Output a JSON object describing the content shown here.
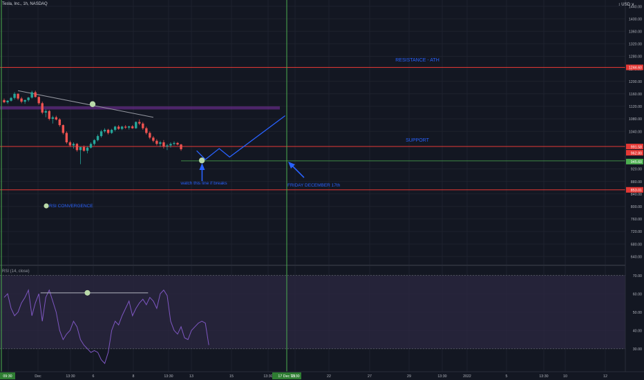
{
  "header": {
    "symbol": "Tesla, Inc., 1h, NASDAQ",
    "currency": "↕ USD ∨"
  },
  "rsi": {
    "title": "RSI (14, close)"
  },
  "annotations": {
    "resistance": "RESISTANCE - ATH",
    "support": "SUPPORT",
    "watch": "watch this line if breaks",
    "friday": "FRIDAY DECEMBER 17th",
    "rsi_conv": "RSI CONVERGENCE"
  },
  "colors": {
    "background": "#131722",
    "grid": "#1e222d",
    "up": "#26a69a",
    "down": "#ef5350",
    "level": "#e53935",
    "vline": "#4caf50",
    "projection": "#2962ff",
    "zone": "#7b2fa3",
    "marker": "#b9d9a8",
    "rsi_line": "#7e57c2",
    "rsi_band": "#2a2740",
    "axis_text": "#b2b5be"
  },
  "chart_data": [
    {
      "type": "candlestick",
      "title": "Tesla, Inc., 1h, NASDAQ",
      "y_axis_ticks": [
        640,
        680,
        720,
        760,
        800,
        840,
        880,
        920,
        1040,
        1080,
        1120,
        1160,
        1200,
        1240,
        1280,
        1320,
        1360,
        1400,
        1440
      ],
      "ylim": [
        625,
        1460
      ],
      "x_axis_labels": [
        "09:30",
        "Dec",
        "13:30",
        "6",
        "8",
        "13:30",
        "13",
        "15",
        "13:30",
        "17 Dec '21",
        "13:30",
        "22",
        "27",
        "29",
        "13:30",
        "2022",
        "5",
        "13:30",
        "10",
        "12"
      ],
      "price_labels": [
        {
          "text": "1244.60",
          "value": 1244.6,
          "color": "#e53935"
        },
        {
          "text": "991.58",
          "value": 991.58,
          "color": "#e53935"
        },
        {
          "text": "962.80",
          "value": 962.8,
          "color": "#e53935"
        },
        {
          "text": "945.60",
          "value": 945.6,
          "color": "#4caf50"
        },
        {
          "text": "853.01",
          "value": 853.01,
          "color": "#e53935"
        }
      ],
      "levels": [
        {
          "value": 1244.6,
          "label": "RESISTANCE - ATH"
        },
        {
          "value": 991.58,
          "label": "SUPPORT"
        },
        {
          "value": 853.01,
          "label": ""
        }
      ],
      "watch_level": 945.6,
      "zone": [
        1110,
        1120
      ],
      "candles": [
        [
          1140,
          1145,
          1130,
          1133
        ],
        [
          1133,
          1140,
          1128,
          1138
        ],
        [
          1138,
          1150,
          1135,
          1147
        ],
        [
          1147,
          1165,
          1142,
          1160
        ],
        [
          1160,
          1162,
          1140,
          1145
        ],
        [
          1145,
          1150,
          1130,
          1135
        ],
        [
          1135,
          1142,
          1128,
          1140
        ],
        [
          1140,
          1150,
          1135,
          1148
        ],
        [
          1148,
          1170,
          1145,
          1165
        ],
        [
          1165,
          1170,
          1148,
          1150
        ],
        [
          1150,
          1152,
          1125,
          1130
        ],
        [
          1130,
          1135,
          1095,
          1100
        ],
        [
          1100,
          1110,
          1085,
          1105
        ],
        [
          1105,
          1108,
          1075,
          1080
        ],
        [
          1080,
          1090,
          1065,
          1085
        ],
        [
          1085,
          1090,
          1075,
          1078
        ],
        [
          1078,
          1082,
          1055,
          1060
        ],
        [
          1060,
          1062,
          1030,
          1035
        ],
        [
          1035,
          1040,
          1000,
          1005
        ],
        [
          1005,
          1010,
          990,
          995
        ],
        [
          995,
          1005,
          985,
          1000
        ],
        [
          1000,
          1003,
          975,
          980
        ],
        [
          980,
          985,
          935,
          990
        ],
        [
          990,
          995,
          975,
          978
        ],
        [
          978,
          992,
          970,
          988
        ],
        [
          988,
          1005,
          985,
          1000
        ],
        [
          1000,
          1015,
          995,
          1012
        ],
        [
          1012,
          1030,
          1008,
          1025
        ],
        [
          1025,
          1045,
          1020,
          1040
        ],
        [
          1040,
          1050,
          1035,
          1045
        ],
        [
          1045,
          1048,
          1030,
          1035
        ],
        [
          1035,
          1048,
          1032,
          1045
        ],
        [
          1045,
          1058,
          1040,
          1055
        ],
        [
          1055,
          1060,
          1045,
          1048
        ],
        [
          1048,
          1058,
          1044,
          1055
        ],
        [
          1055,
          1060,
          1048,
          1052
        ],
        [
          1052,
          1058,
          1046,
          1056
        ],
        [
          1056,
          1060,
          1048,
          1050
        ],
        [
          1050,
          1072,
          1048,
          1070
        ],
        [
          1070,
          1078,
          1060,
          1065
        ],
        [
          1065,
          1070,
          1045,
          1050
        ],
        [
          1050,
          1055,
          1030,
          1035
        ],
        [
          1035,
          1040,
          1015,
          1020
        ],
        [
          1020,
          1025,
          1005,
          1010
        ],
        [
          1010,
          1015,
          995,
          1000
        ],
        [
          1000,
          1010,
          990,
          1005
        ],
        [
          1005,
          1012,
          985,
          992
        ],
        [
          992,
          1000,
          980,
          995
        ],
        [
          995,
          1005,
          988,
          1000
        ],
        [
          1000,
          1008,
          995,
          1003
        ],
        [
          1003,
          1006,
          995,
          998
        ],
        [
          998,
          1000,
          978,
          983
        ]
      ],
      "trendline": [
        [
          4,
          1170
        ],
        [
          43,
          1085
        ]
      ],
      "markers": [
        {
          "x": 25.5,
          "y": 1127
        },
        {
          "x": 57,
          "y": 947
        }
      ],
      "projection": [
        [
          55.5,
          978
        ],
        [
          58,
          950
        ],
        [
          62,
          985
        ],
        [
          65,
          958
        ],
        [
          81,
          1090
        ]
      ],
      "vertical_markers": [
        "09:30",
        "17 Dec '21"
      ]
    },
    {
      "type": "line",
      "title": "RSI (14, close)",
      "y_axis_ticks": [
        30,
        40,
        50,
        60,
        70
      ],
      "ylim": [
        22,
        74
      ],
      "band": [
        30,
        70
      ],
      "values": [
        58,
        60,
        52,
        48,
        50,
        55,
        58,
        62,
        48,
        55,
        60,
        45,
        58,
        62,
        56,
        50,
        40,
        35,
        38,
        40,
        45,
        42,
        35,
        32,
        30,
        28,
        29,
        28,
        24,
        22,
        28,
        40,
        45,
        43,
        48,
        52,
        56,
        48,
        52,
        55,
        57,
        54,
        58,
        56,
        52,
        60,
        62,
        59,
        45,
        40,
        38,
        42,
        36,
        35,
        40,
        42,
        44,
        45,
        44,
        32
      ],
      "trendline": [
        [
          10.5,
          60.5
        ],
        [
          41.5,
          60.5
        ]
      ],
      "markers": [
        {
          "x": 24,
          "y": 60.5
        }
      ]
    }
  ]
}
